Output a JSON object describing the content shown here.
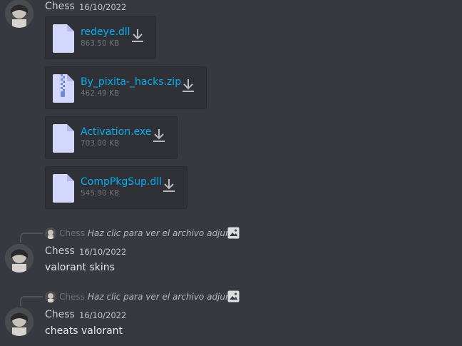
{
  "messages": [
    {
      "username": "Chess",
      "timestamp": "16/10/2022",
      "attachments": [
        {
          "name": "redeye.dll",
          "size": "863.50 KB",
          "type": "file"
        },
        {
          "name": "By_pixita-_hacks.zip",
          "size": "462.49 KB",
          "type": "zip"
        },
        {
          "name": "Activation.exe",
          "size": "703.00 KB",
          "type": "file"
        },
        {
          "name": "CompPkgSup.dll",
          "size": "545.90 KB",
          "type": "file"
        }
      ]
    },
    {
      "reply": {
        "username": "Chess",
        "text": "Haz clic para ver el archivo adjunto"
      },
      "username": "Chess",
      "timestamp": "16/10/2022",
      "text": "valorant skins"
    },
    {
      "reply": {
        "username": "Chess",
        "text": "Haz clic para ver el archivo adjunto"
      },
      "username": "Chess",
      "timestamp": "16/10/2022",
      "text": "cheats valorant"
    }
  ],
  "icons": {
    "file": "file-icon",
    "zip": "zip-file-icon",
    "download": "download-icon",
    "image": "image-icon"
  },
  "colors": {
    "background": "#36393f",
    "attachment_bg": "#2f3136",
    "link": "#00aff4",
    "file_icon": "#d4d7fc",
    "zip_accent": "#7289da"
  }
}
